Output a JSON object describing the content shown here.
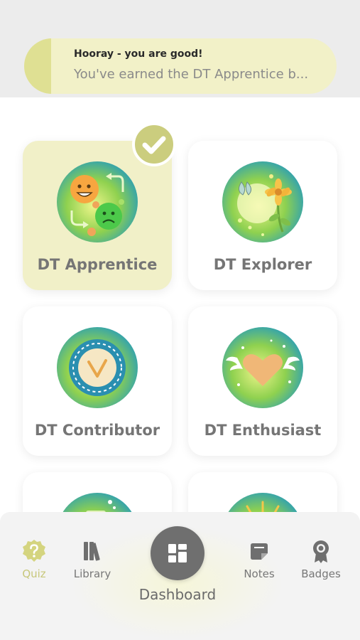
{
  "toast": {
    "title": "Hooray - you are good!",
    "message": "You've earned the DT Apprentice b...",
    "accent_color": "#dfe093",
    "background_color": "#f2f1c8"
  },
  "badges": [
    {
      "label": "DT Apprentice",
      "earned": true,
      "icon": "emotions-icon"
    },
    {
      "label": "DT Explorer",
      "earned": false,
      "icon": "nature-icon"
    },
    {
      "label": "DT Contributor",
      "earned": false,
      "icon": "checkmark-seal-icon"
    },
    {
      "label": "DT Enthusiast",
      "earned": false,
      "icon": "winged-heart-icon"
    },
    {
      "label": "",
      "earned": false,
      "icon": "partial-badge-icon"
    },
    {
      "label": "",
      "earned": false,
      "icon": "sunburst-icon"
    }
  ],
  "nav": {
    "items": [
      {
        "label": "Quiz",
        "icon": "question-icon",
        "active": true
      },
      {
        "label": "Library",
        "icon": "books-icon",
        "active": false
      },
      {
        "label": "Notes",
        "icon": "notes-icon",
        "active": false
      },
      {
        "label": "Badges",
        "icon": "award-icon",
        "active": false
      }
    ],
    "center": {
      "label": "Dashboard",
      "icon": "dashboard-icon"
    }
  },
  "colors": {
    "accent": "#c7c77a",
    "earned_card": "#f1f0c8",
    "text_muted": "#757575"
  }
}
